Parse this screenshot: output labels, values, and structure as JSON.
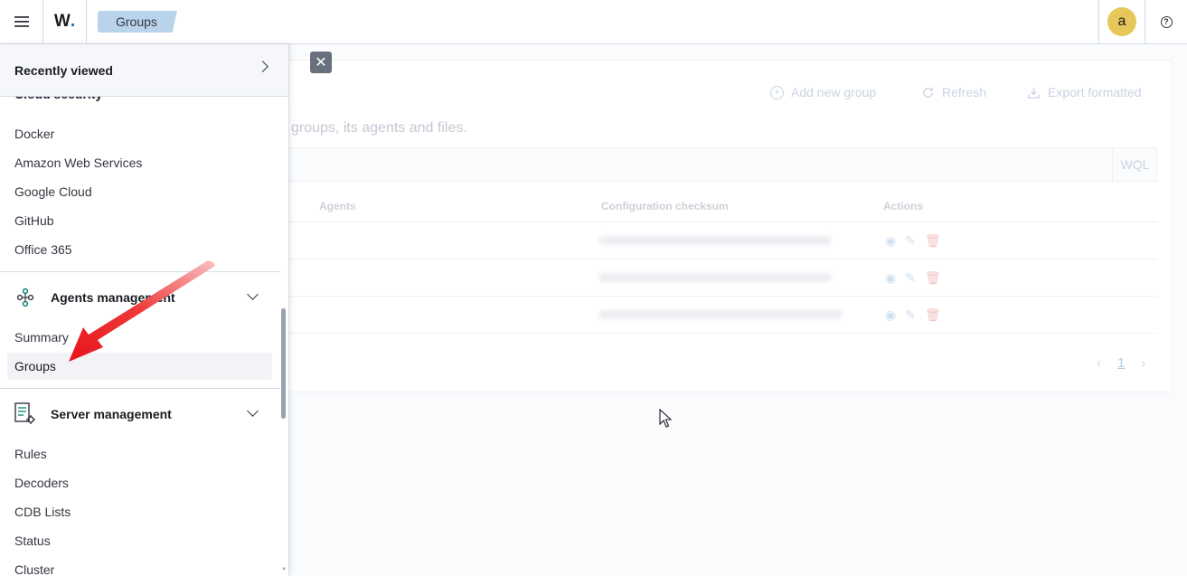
{
  "header": {
    "logo_text": "W",
    "logo_dot": ".",
    "breadcrumb": "Groups",
    "avatar_letter": "a",
    "help_glyph": "?"
  },
  "background": {
    "toolbar": {
      "add_label": "Add new group",
      "refresh_label": "Refresh",
      "export_label": "Export formatted"
    },
    "description": "groups, its agents and files.",
    "search_mode": "WQL",
    "table": {
      "columns": [
        "Agents",
        "Configuration checksum",
        "Actions"
      ]
    },
    "pagination": {
      "current": "1"
    }
  },
  "sidenav": {
    "recently_viewed": "Recently viewed",
    "cloud_security_partial": "Cloud security",
    "cloud_items": [
      "Docker",
      "Amazon Web Services",
      "Google Cloud",
      "GitHub",
      "Office 365"
    ],
    "agents_management": {
      "label": "Agents management",
      "items": [
        "Summary",
        "Groups"
      ]
    },
    "server_management": {
      "label": "Server management",
      "items": [
        "Rules",
        "Decoders",
        "CDB Lists",
        "Status",
        "Cluster"
      ]
    }
  },
  "colors": {
    "accent": "#006bb8",
    "breadcrumb_bg": "#b9d3eb",
    "avatar_bg": "#e6c75a",
    "arrow_red": "#e8141c"
  }
}
